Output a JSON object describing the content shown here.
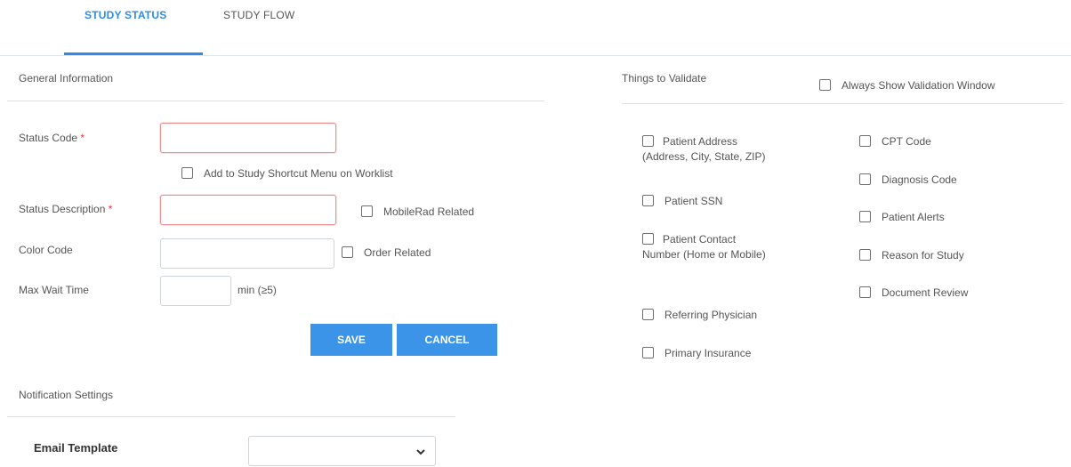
{
  "tabs": [
    {
      "label": "STUDY STATUS",
      "active": true
    },
    {
      "label": "STUDY FLOW",
      "active": false
    }
  ],
  "general": {
    "title": "General Information",
    "status_code_label": "Status Code",
    "required_mark": "*",
    "status_code_value": "",
    "shortcut_checkbox": {
      "label": "Add to Study Shortcut Menu on Worklist",
      "checked": false
    },
    "status_description_label": "Status Description",
    "status_description_value": "",
    "mobilerad_checkbox": {
      "label": "MobileRad Related",
      "checked": false
    },
    "color_code_label": "Color Code",
    "color_code_value": "",
    "order_related_checkbox": {
      "label": "Order Related",
      "checked": false
    },
    "max_wait_label": "Max Wait Time",
    "max_wait_value": "",
    "max_wait_suffix": "min (≥5)",
    "save_label": "SAVE",
    "cancel_label": "CANCEL"
  },
  "notification": {
    "title": "Notification Settings",
    "email_template_label": "Email Template",
    "email_template_value": ""
  },
  "validate": {
    "title": "Things to Validate",
    "always_show": {
      "label": "Always Show Validation Window",
      "checked": false
    },
    "left_items": [
      {
        "label_line1": "Patient Address",
        "label_rest": "(Address, City, State, ZIP)",
        "checked": false
      },
      {
        "label": "Patient SSN",
        "checked": false
      },
      {
        "label_line1": "Patient Contact",
        "label_rest": "Number (Home or Mobile)",
        "checked": false
      },
      {
        "label": "Referring Physician",
        "checked": false
      },
      {
        "label": "Primary Insurance",
        "checked": false
      }
    ],
    "right_items": [
      {
        "label": "CPT Code",
        "checked": false
      },
      {
        "label": "Diagnosis Code",
        "checked": false
      },
      {
        "label": "Patient Alerts",
        "checked": false
      },
      {
        "label": "Reason for Study",
        "checked": false
      },
      {
        "label": "Document Review",
        "checked": false
      }
    ]
  },
  "colors": {
    "accent": "#2f8be6",
    "button": "#3c94e8",
    "required": "#e53935",
    "error_border": "#ec8f8f"
  }
}
